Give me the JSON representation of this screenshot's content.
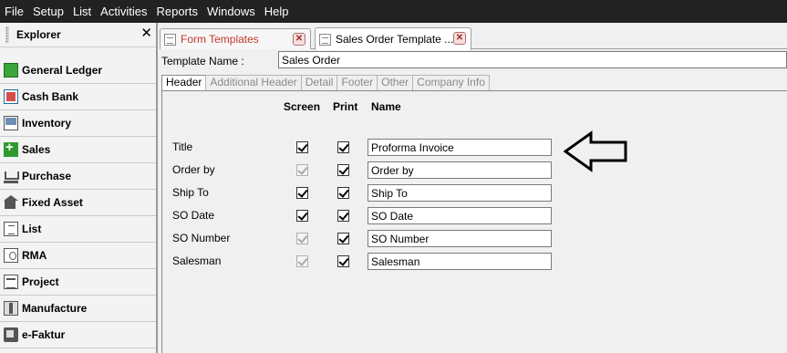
{
  "menu": [
    "File",
    "Setup",
    "List",
    "Activities",
    "Reports",
    "Windows",
    "Help"
  ],
  "explorer": {
    "title": "Explorer",
    "close_glyph": "✕",
    "items": [
      {
        "label": "General Ledger",
        "icon": "general-ledger-icon"
      },
      {
        "label": "Cash Bank",
        "icon": "cash-bank-icon"
      },
      {
        "label": "Inventory",
        "icon": "inventory-icon"
      },
      {
        "label": "Sales",
        "icon": "sales-icon"
      },
      {
        "label": "Purchase",
        "icon": "purchase-icon"
      },
      {
        "label": "Fixed Asset",
        "icon": "fixed-asset-icon"
      },
      {
        "label": "List",
        "icon": "list-icon"
      },
      {
        "label": "RMA",
        "icon": "rma-icon"
      },
      {
        "label": "Project",
        "icon": "project-icon"
      },
      {
        "label": "Manufacture",
        "icon": "manufacture-icon"
      },
      {
        "label": "e-Faktur",
        "icon": "e-faktur-icon"
      }
    ]
  },
  "tabs": [
    {
      "label": "Form Templates",
      "active": false
    },
    {
      "label": "Sales Order Template ...",
      "active": true
    }
  ],
  "template": {
    "name_label": "Template Name :",
    "name_value": "Sales Order"
  },
  "subtabs": [
    "Header",
    "Additional Header",
    "Detail",
    "Footer",
    "Other",
    "Company Info"
  ],
  "columns": {
    "screen": "Screen",
    "print": "Print",
    "name": "Name"
  },
  "rows": [
    {
      "label": "Title",
      "screen": true,
      "screen_enabled": true,
      "print": true,
      "name": "Proforma Invoice"
    },
    {
      "label": "Order by",
      "screen": true,
      "screen_enabled": false,
      "print": true,
      "name": "Order by"
    },
    {
      "label": "Ship To",
      "screen": true,
      "screen_enabled": true,
      "print": true,
      "name": "Ship To"
    },
    {
      "label": "SO Date",
      "screen": true,
      "screen_enabled": true,
      "print": true,
      "name": "SO Date"
    },
    {
      "label": "SO Number",
      "screen": true,
      "screen_enabled": false,
      "print": true,
      "name": "SO Number"
    },
    {
      "label": "Salesman",
      "screen": true,
      "screen_enabled": false,
      "print": true,
      "name": "Salesman"
    }
  ],
  "colors": {
    "menubar": "#222222",
    "active_tab_text": "#c0392b",
    "annotation_arrow": "#000000"
  }
}
